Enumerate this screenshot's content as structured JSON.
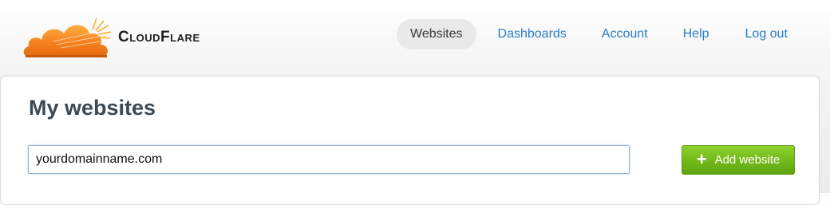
{
  "brand": {
    "name": "CloudFlare",
    "logo_icon": "cloud-sun-logo-icon",
    "colors": {
      "cloud_orange": "#f6821f",
      "cloud_light": "#fbad41",
      "text": "#1f1f1f"
    }
  },
  "nav": {
    "items": [
      {
        "label": "Websites",
        "active": true
      },
      {
        "label": "Dashboards",
        "active": false
      },
      {
        "label": "Account",
        "active": false
      },
      {
        "label": "Help",
        "active": false
      },
      {
        "label": "Log out",
        "active": false
      }
    ],
    "link_color": "#2a7dc4"
  },
  "main": {
    "title": "My websites",
    "domain_input": {
      "value": "yourdomainname.com",
      "placeholder": ""
    },
    "add_button": {
      "label": "Add website",
      "icon": "plus-icon",
      "color": "#72b81a"
    }
  }
}
